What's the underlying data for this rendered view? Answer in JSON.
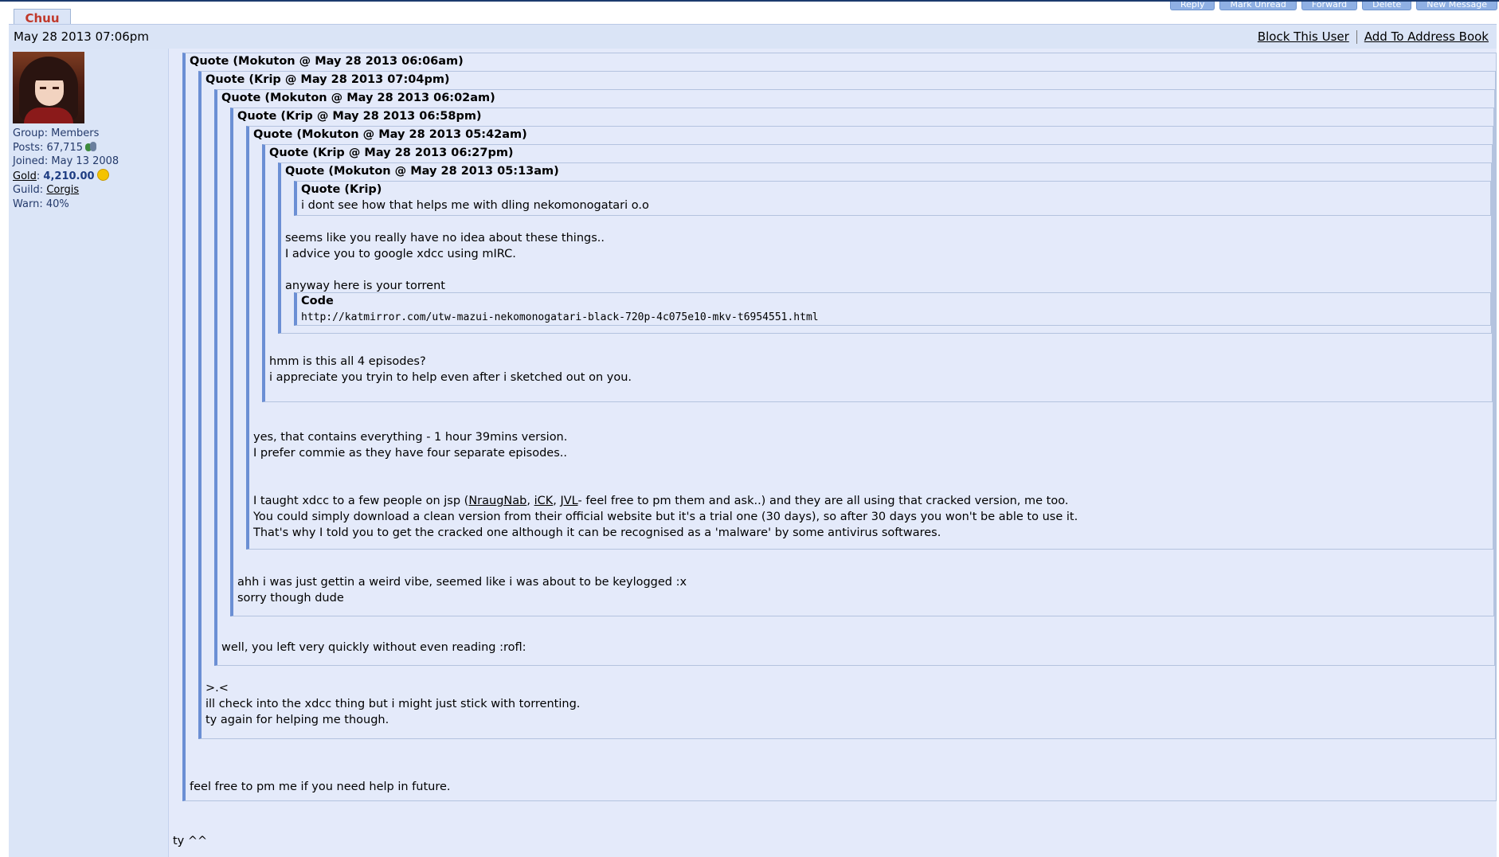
{
  "author": {
    "name": "Chuu"
  },
  "topbar": {
    "actions": [
      "Reply",
      "Mark Unread",
      "Forward",
      "Delete",
      "New Message"
    ]
  },
  "post": {
    "date": "May 28 2013 07:06pm",
    "block_link": "Block This User",
    "address_link": "Add To Address Book"
  },
  "profile": {
    "group_label": "Group:",
    "group": "Members",
    "posts_label": "Posts:",
    "posts": "67,715",
    "joined_label": "Joined:",
    "joined": "May 13 2008",
    "gold_label": "Gold",
    "gold": "4,210.00",
    "guild_label": "Guild:",
    "guild": "Corgis",
    "warn_label": "Warn:",
    "warn": "40%"
  },
  "quotes": {
    "q1": {
      "title": "Quote (Mokuton @ May 28 2013 06:06am)",
      "reply": "feel free to pm me if you need help in future."
    },
    "q2": {
      "title": "Quote (Krip @ May 28 2013 07:04pm)",
      "reply_l1": ">.<",
      "reply_l2": "ill check into the xdcc thing but i might just stick with torrenting.",
      "reply_l3": "ty again for helping me though."
    },
    "q3": {
      "title": "Quote (Mokuton @ May 28 2013 06:02am)",
      "reply": "well, you left very quickly without even reading :rofl:"
    },
    "q4": {
      "title": "Quote (Krip @ May 28 2013 06:58pm)",
      "reply_l1": "ahh i was just gettin a weird vibe, seemed like i was about to be keylogged :x",
      "reply_l2": "sorry though dude"
    },
    "q5": {
      "title": "Quote (Mokuton @ May 28 2013 05:42am)",
      "reply_l1": "yes, that contains everything - 1 hour 39mins version.",
      "reply_l2": "I prefer commie as they have four separate episodes..",
      "reply_l3_pre": "I taught xdcc to a few people on jsp (",
      "link1": "NraugNab",
      "comma1": ", ",
      "link2": "iCK",
      "comma2": ", ",
      "link3": "JVL",
      "reply_l3_post": "- feel free to pm them and ask..) and they are all using that cracked version, me too.",
      "reply_l4": "You could simply download a clean version from their official website but it's a trial one (30 days), so after 30 days you won't be able to use it.",
      "reply_l5": "That's why I told you to get the cracked one although it can be recognised as a 'malware' by some antivirus softwares."
    },
    "q6": {
      "title": "Quote (Krip @ May 28 2013 06:27pm)",
      "reply_l1": "hmm is this all 4 episodes?",
      "reply_l2": "i appreciate you tryin to help even after i sketched out on you."
    },
    "q7": {
      "title": "Quote (Mokuton @ May 28 2013 05:13am)",
      "reply_l1": "seems like you really have no idea about these things..",
      "reply_l2": "I advice you to google xdcc using mIRC.",
      "reply_l3": "anyway here is your torrent"
    },
    "q8": {
      "title": "Quote (Krip)",
      "text": "i dont see how that helps me with dling nekomonogatari o.o"
    }
  },
  "code": {
    "header": "Code",
    "text": "http://katmirror.com/utw-mazui-nekomonogatari-black-720p-4c075e10-mkv-t6954551.html"
  },
  "closing": "ty ^^"
}
